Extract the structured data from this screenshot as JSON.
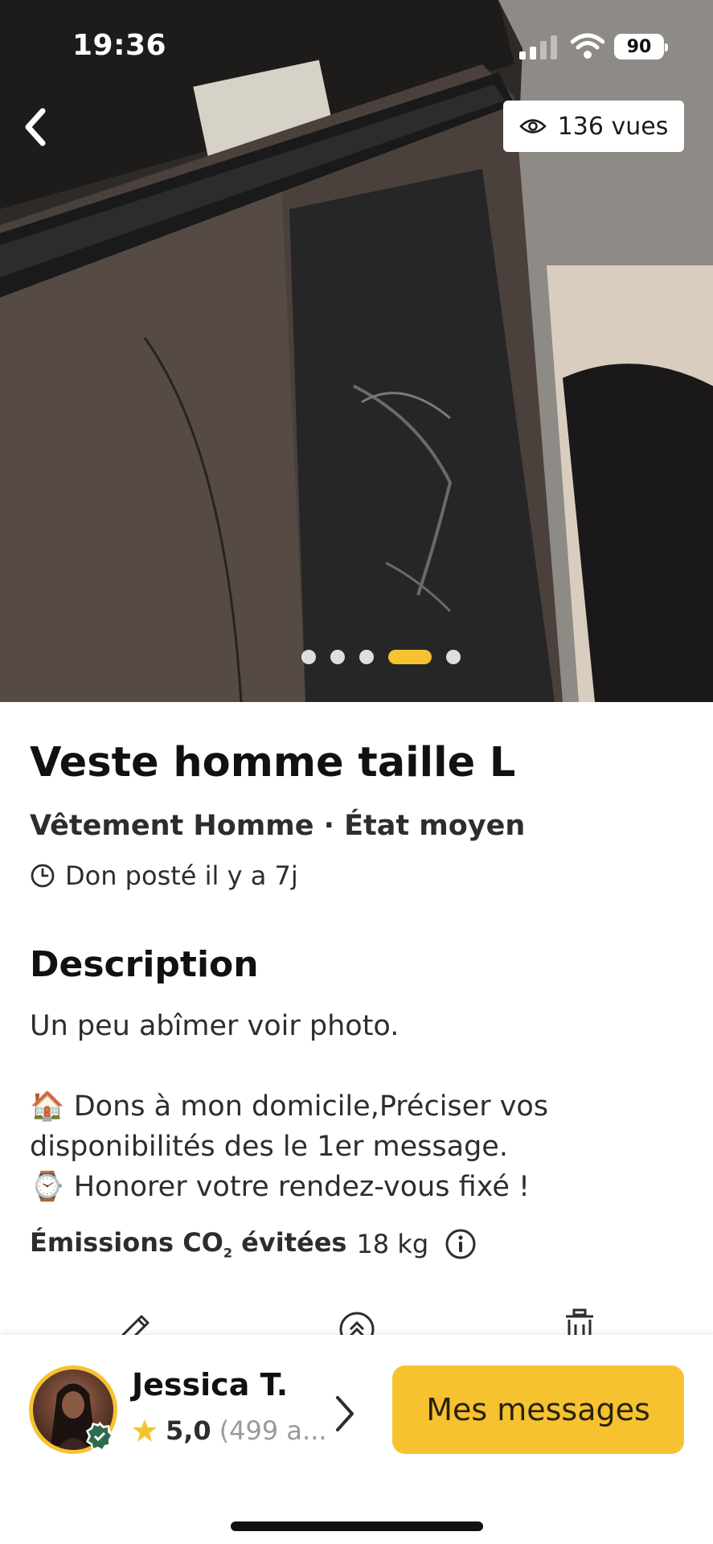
{
  "status_bar": {
    "time": "19:36",
    "battery_level": "90",
    "icons": [
      "signal-icon",
      "wifi-icon",
      "battery-icon"
    ]
  },
  "hero": {
    "views_label": "136 vues",
    "photo_count": 5,
    "active_photo_index": 3,
    "photo_subject": "damaged dark leather jacket"
  },
  "listing": {
    "title": "Veste homme taille L",
    "subtitle": "Vêtement Homme · État moyen",
    "posted": "Don posté il y a 7j"
  },
  "description": {
    "heading": "Description",
    "line1": "Un peu abîmer voir photo.",
    "line2_emoji": "🏠",
    "line2": " Dons à mon domicile,Préciser vos",
    "line3": "disponibilités des le 1er message.",
    "line4_emoji": "⌚",
    "line4": " Honorer votre rendez-vous fixé !"
  },
  "co2": {
    "label_prefix": "Émissions CO",
    "label_sub": "2",
    "label_suffix": " évitées",
    "value": "18 kg"
  },
  "actions": [
    "edit-icon",
    "boost-icon",
    "delete-icon"
  ],
  "seller": {
    "name": "Jessica T.",
    "rating": "5,0",
    "count": "(499 a..."
  },
  "messages_button": "Mes messages",
  "colors": {
    "accent": "#f6c22f",
    "text": "#1c1c1c",
    "muted": "#9a9a9a",
    "badge_green": "#2f6b4f"
  }
}
